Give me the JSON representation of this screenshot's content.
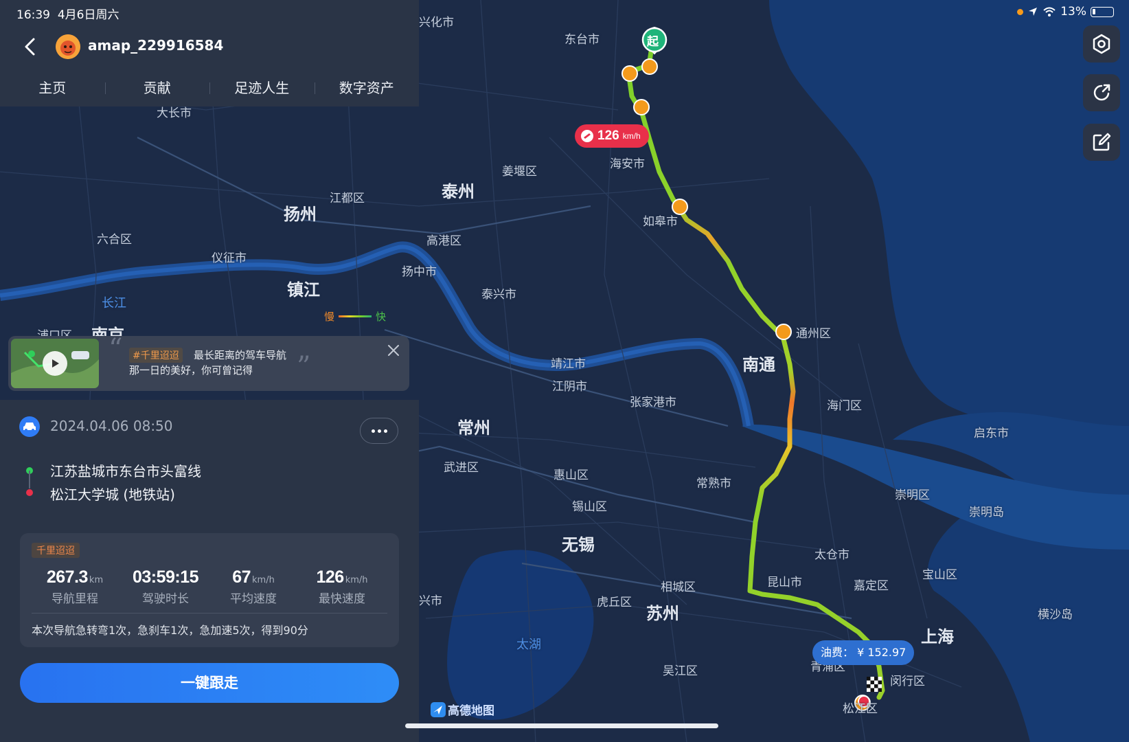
{
  "status_bar": {
    "time": "16:39",
    "date": "4月6日周六",
    "battery": "13%"
  },
  "header": {
    "username": "amap_229916584"
  },
  "tabs": [
    {
      "label": "主页"
    },
    {
      "label": "贡献"
    },
    {
      "label": "足迹人生"
    },
    {
      "label": "数字资产"
    }
  ],
  "promo": {
    "tag": "#千里迢迢",
    "line1": "最长距离的驾车导航",
    "line2": "那一日的美好，你可曾记得"
  },
  "trip": {
    "datetime": "2024.04.06 08:50",
    "start": "江苏盐城市东台市头富线",
    "end": "松江大学城 (地铁站)",
    "badge": "千里迢迢",
    "stats": [
      {
        "value": "267.3",
        "unit": "km",
        "label": "导航里程"
      },
      {
        "value": "03:59:15",
        "unit": "",
        "label": "驾驶时长"
      },
      {
        "value": "67",
        "unit": "km/h",
        "label": "平均速度"
      },
      {
        "value": "126",
        "unit": "km/h",
        "label": "最快速度"
      }
    ],
    "summary": "本次导航急转弯1次，急刹车1次，急加速5次，得到90分",
    "follow_button": "一键跟走"
  },
  "map": {
    "start_marker": "起",
    "max_speed": {
      "value": "126",
      "unit": "km/h"
    },
    "fuel": "油费： ¥ 152.97",
    "legend": {
      "slow": "慢",
      "fast": "快"
    },
    "logo": "高德地图",
    "labels": [
      "兴化市",
      "东台市",
      "海安市",
      "姜堰区",
      "泰州",
      "江都区",
      "扬州",
      "六合区",
      "仪征市",
      "镇江",
      "长江",
      "浦口区",
      "南京",
      "高港区",
      "扬中市",
      "泰兴市",
      "如皋市",
      "通州区",
      "南通",
      "靖江市",
      "江阴市",
      "张家港市",
      "海门区",
      "启东市",
      "常州",
      "武进区",
      "惠山区",
      "锡山区",
      "常熟市",
      "崇明区",
      "崇明岛",
      "无锡",
      "太仓市",
      "昆山市",
      "嘉定区",
      "宝山区",
      "相城区",
      "虎丘区",
      "苏州",
      "上海",
      "横沙岛",
      "太湖",
      "吴江区",
      "青浦区",
      "闵行区",
      "松江区",
      "兴市",
      "大长市"
    ]
  },
  "colors": {
    "accent": "#2f7cf6",
    "speed_badge": "#e8304a",
    "fuel_badge": "#2e6fd0",
    "route_start": "#2fcf5a",
    "route_end": "#e8304a"
  }
}
